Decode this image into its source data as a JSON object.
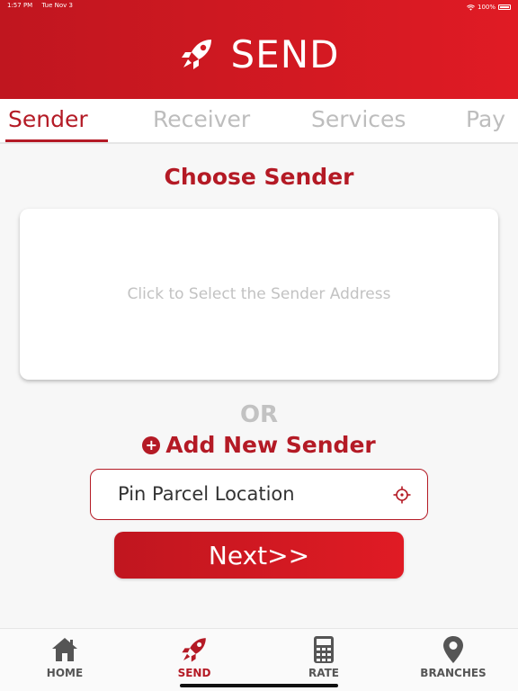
{
  "status_bar": {
    "time": "1:57 PM",
    "date": "Tue Nov 3",
    "battery": "100%"
  },
  "header": {
    "title": "SEND",
    "icon": "rocket-icon"
  },
  "tabs": [
    {
      "label": "Sender",
      "active": true
    },
    {
      "label": "Receiver",
      "active": false
    },
    {
      "label": "Services",
      "active": false
    },
    {
      "label": "Pay",
      "active": false
    }
  ],
  "main": {
    "title": "Choose Sender",
    "address_placeholder": "Click to Select the Sender Address",
    "or_text": "OR",
    "add_new_sender": "Add New Sender",
    "pin_location": "Pin Parcel Location",
    "next_label": "Next>>"
  },
  "bottom_nav": [
    {
      "label": "HOME",
      "icon": "home-icon",
      "active": false
    },
    {
      "label": "SEND",
      "icon": "rocket-icon",
      "active": true
    },
    {
      "label": "RATE",
      "icon": "calculator-icon",
      "active": false
    },
    {
      "label": "BRANCHES",
      "icon": "location-pin-icon",
      "active": false
    }
  ],
  "colors": {
    "brand_red": "#c0161f",
    "accent_red": "#b41a25",
    "muted_gray": "#c2c2c2"
  }
}
